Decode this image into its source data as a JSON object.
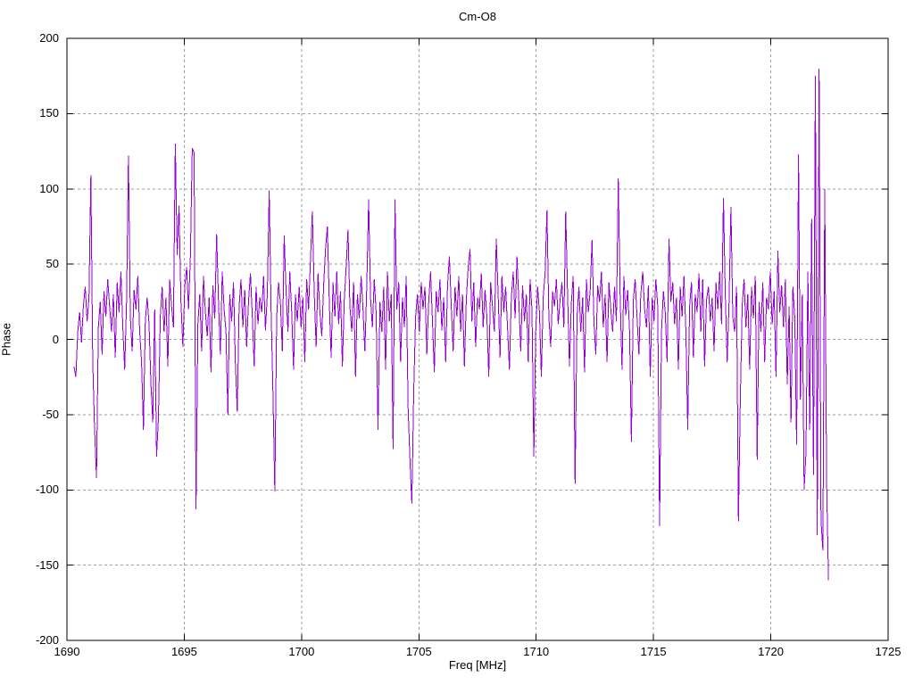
{
  "chart": {
    "title": "Cm-O8",
    "xlabel": "Freq [MHz]",
    "ylabel": "Phase"
  },
  "chart_data": {
    "type": "line",
    "title": "Cm-O8",
    "xlabel": "Freq [MHz]",
    "ylabel": "Phase",
    "xlim": [
      1690,
      1725
    ],
    "ylim": [
      -200,
      200
    ],
    "xticks": [
      1690,
      1695,
      1700,
      1705,
      1710,
      1715,
      1720,
      1725
    ],
    "yticks": [
      -200,
      -150,
      -100,
      -50,
      0,
      50,
      100,
      150,
      200
    ],
    "grid": true,
    "legend_position": "none",
    "line_color": "#9400d3",
    "grid_color": "#9e9e9e",
    "border_color": "#000000",
    "series": [
      {
        "name": "phase",
        "x_start": 1690.3,
        "x_step": 0.08,
        "values": [
          -18,
          -25,
          5,
          18,
          -2,
          22,
          35,
          12,
          28,
          109,
          -15,
          -60,
          -92,
          8,
          25,
          -10,
          32,
          15,
          40,
          22,
          5,
          30,
          -12,
          38,
          18,
          45,
          8,
          -20,
          25,
          122,
          15,
          -8,
          33,
          20,
          42,
          5,
          -15,
          -60,
          12,
          28,
          10,
          -30,
          -55,
          20,
          -78,
          -52,
          15,
          35,
          5,
          28,
          -18,
          40,
          22,
          8,
          130,
          56,
          89,
          25,
          -5,
          35,
          48,
          20,
          55,
          127,
          124,
          -113,
          10,
          30,
          -8,
          42,
          18,
          2,
          28,
          -22,
          36,
          14,
          70,
          25,
          -10,
          45,
          20,
          5,
          -50,
          30,
          12,
          38,
          -15,
          -48,
          22,
          40,
          8,
          33,
          -5,
          26,
          44,
          15,
          -18,
          35,
          10,
          28,
          18,
          42,
          6,
          30,
          99,
          20,
          -35,
          -101,
          15,
          38,
          24,
          -8,
          69,
          32,
          5,
          45,
          18,
          -20,
          30,
          12,
          35,
          8,
          28,
          -15,
          40,
          20,
          52,
          85,
          30,
          -5,
          44,
          18,
          2,
          36,
          60,
          75,
          25,
          -12,
          38,
          15,
          45,
          10,
          32,
          -18,
          26,
          48,
          73,
          22,
          5,
          38,
          -25,
          30,
          14,
          42,
          20,
          -8,
          35,
          93,
          28,
          8,
          40,
          18,
          -60,
          25,
          5,
          35,
          -20,
          45,
          12,
          30,
          -73,
          93,
          20,
          38,
          -15,
          28,
          8,
          42,
          -45,
          -80,
          -109,
          -35,
          15,
          30,
          5,
          38,
          20,
          35,
          -10,
          25,
          45,
          12,
          -22,
          32,
          18,
          40,
          6,
          28,
          -15,
          36,
          55,
          22,
          -8,
          35,
          15,
          42,
          5,
          30,
          -18,
          26,
          48,
          60,
          12,
          38,
          -5,
          28,
          20,
          44,
          8,
          33,
          15,
          -25,
          38,
          22,
          5,
          67,
          30,
          -12,
          42,
          18,
          35,
          8,
          -20,
          28,
          45,
          14,
          55,
          25,
          -8,
          36,
          12,
          30,
          -15,
          40,
          20,
          -78,
          5,
          35,
          18,
          -25,
          28,
          44,
          86,
          15,
          -5,
          32,
          22,
          40,
          10,
          26,
          38,
          8,
          85,
          30,
          -18,
          24,
          42,
          -96,
          15,
          35,
          5,
          28,
          -22,
          40,
          18,
          32,
          66,
          12,
          -10,
          36,
          25,
          45,
          8,
          30,
          -15,
          38,
          20,
          5,
          35,
          12,
          107,
          28,
          -20,
          42,
          16,
          33,
          6,
          -68,
          25,
          40,
          15,
          -10,
          30,
          45,
          20,
          8,
          36,
          -25,
          28,
          12,
          40,
          22,
          -124,
          5,
          32,
          18,
          -15,
          67,
          25,
          38,
          10,
          28,
          -20,
          35,
          15,
          42,
          6,
          -60,
          22,
          38,
          -12,
          30,
          18,
          44,
          5,
          40,
          -18,
          26,
          35,
          12,
          28,
          -8,
          38,
          20,
          45,
          10,
          94,
          30,
          -15,
          25,
          88,
          15,
          5,
          35,
          -121,
          -40,
          22,
          40,
          8,
          30,
          -20,
          35,
          14,
          42,
          -80,
          25,
          5,
          38,
          -15,
          28,
          20,
          45,
          10,
          32,
          -25,
          59,
          18,
          36,
          8,
          40,
          -30,
          22,
          -55,
          35,
          15,
          -70,
          123,
          -40,
          30,
          -100,
          -75,
          45,
          -60,
          80,
          -90,
          175,
          -130,
          180,
          -120,
          -140,
          100,
          -95,
          -160
        ]
      }
    ]
  }
}
